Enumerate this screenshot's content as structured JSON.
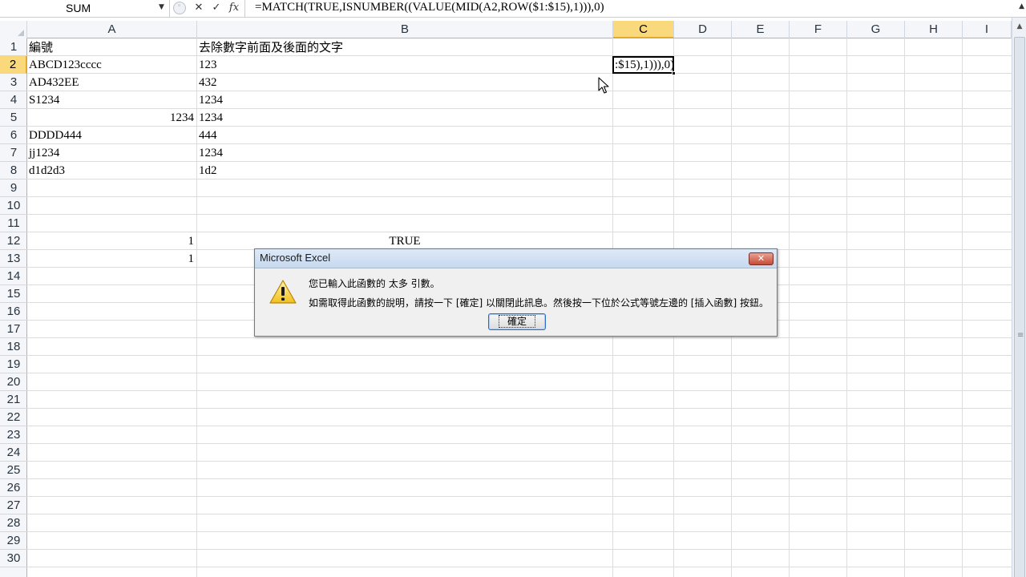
{
  "formula_bar": {
    "name_box": "SUM",
    "cancel_glyph": "✕",
    "enter_glyph": "✓",
    "insert_function_glyph": "fx",
    "formula": "=MATCH(TRUE,ISNUMBER((VALUE(MID(A2,ROW($1:$15),1))),0)"
  },
  "columns": [
    {
      "id": "A",
      "label": "A"
    },
    {
      "id": "B",
      "label": "B"
    },
    {
      "id": "C",
      "label": "C",
      "active": true
    },
    {
      "id": "D",
      "label": "D"
    },
    {
      "id": "E",
      "label": "E"
    },
    {
      "id": "F",
      "label": "F"
    },
    {
      "id": "G",
      "label": "G"
    },
    {
      "id": "H",
      "label": "H"
    },
    {
      "id": "I",
      "label": "I"
    }
  ],
  "rows": [
    "1",
    "2",
    "3",
    "4",
    "5",
    "6",
    "7",
    "8",
    "9",
    "10",
    "11",
    "12",
    "13",
    "14",
    "15",
    "16",
    "17",
    "18",
    "19",
    "20",
    "21",
    "22",
    "23",
    "24",
    "25",
    "26",
    "27",
    "28",
    "29",
    "30"
  ],
  "active_row": "2",
  "cells": {
    "A1": "編號",
    "B1": "去除數字前面及後面的文字",
    "A2": "ABCD123cccc",
    "B2": "123",
    "A3": "AD432EE",
    "B3": "432",
    "A4": "S1234",
    "B4": "1234",
    "A5": "1234",
    "B5": "1234",
    "A6": "DDDD444",
    "B6": "444",
    "A7": "jj1234",
    "B7": "1234",
    "A8": "d1d2d3",
    "B8": "1d2",
    "A12": "1",
    "B12": "TRUE",
    "A13": "1"
  },
  "active_cell": {
    "address": "C2",
    "edit_text": ":$15),1))),0)"
  },
  "dialog": {
    "title": "Microsoft Excel",
    "close_glyph": "✕",
    "message_1": "您已輸入此函數的 太多 引數。",
    "message_2": "如需取得此函數的說明，請按一下 [確定] 以關閉此訊息。然後按一下位於公式等號左邊的 [插入函數] 按鈕。",
    "ok_label": "確定"
  }
}
